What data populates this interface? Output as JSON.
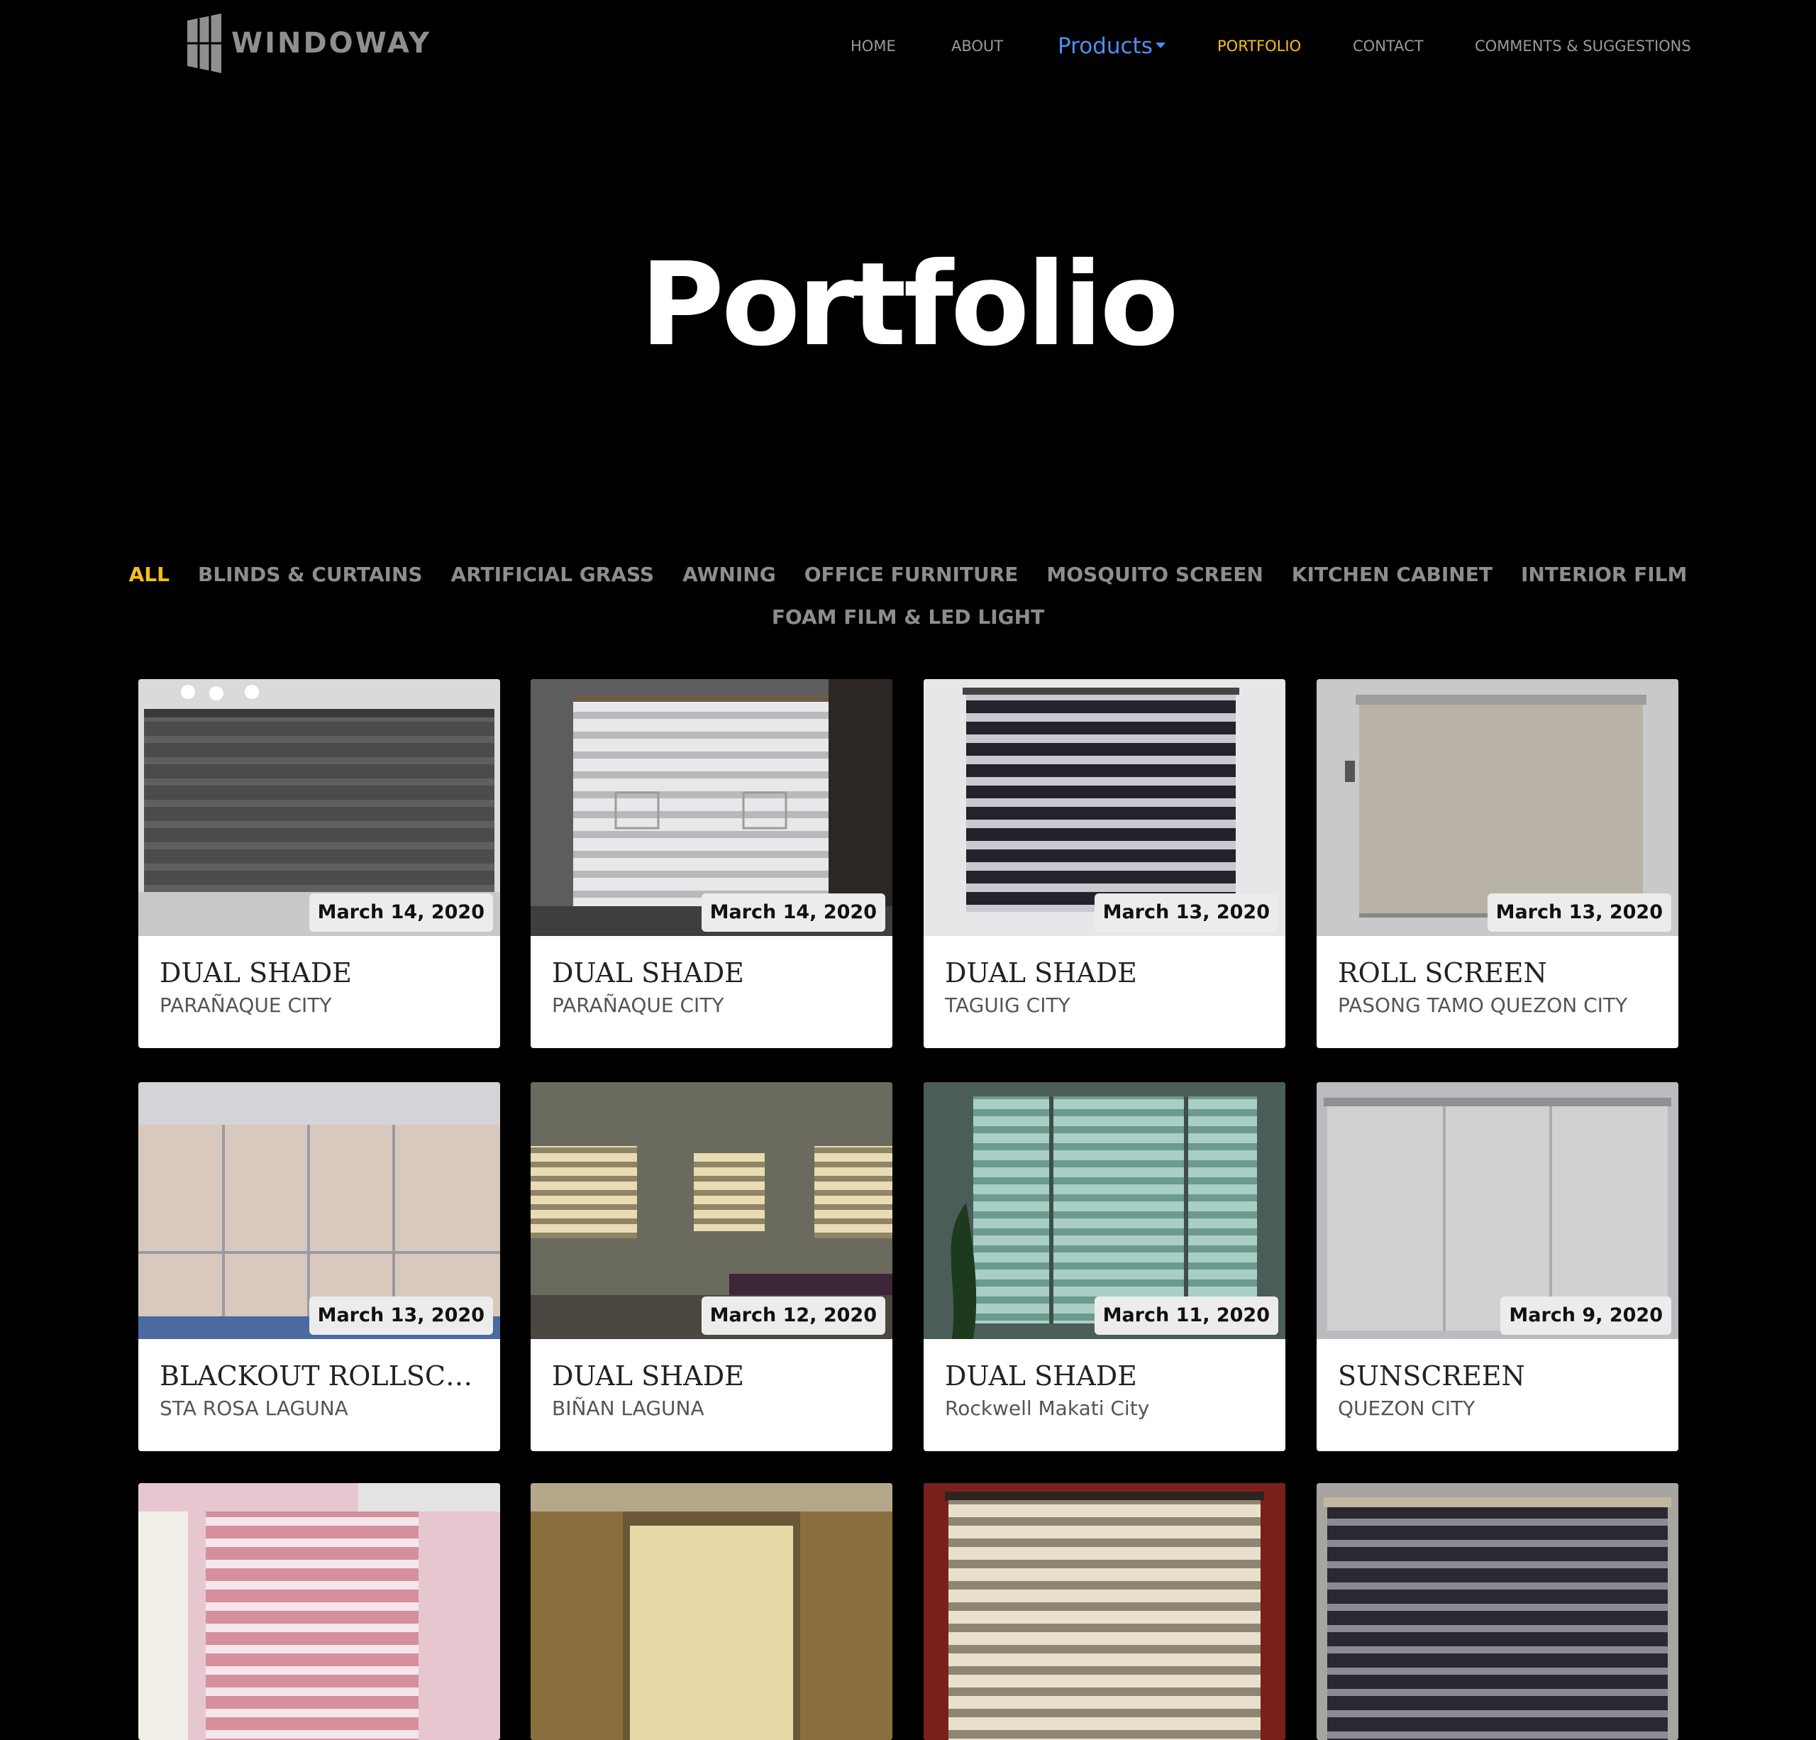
{
  "header": {
    "logo_text": "WINDOWAY",
    "nav": [
      {
        "label": "HOME"
      },
      {
        "label": "ABOUT"
      },
      {
        "label": "Products"
      },
      {
        "label": "PORTFOLIO"
      },
      {
        "label": "CONTACT"
      },
      {
        "label": "COMMENTS & SUGGESTIONS"
      }
    ]
  },
  "hero": {
    "title": "Portfolio"
  },
  "filters": {
    "row1": [
      "ALL",
      "BLINDS & CURTAINS",
      "ARTIFICIAL GRASS",
      "AWNING",
      "OFFICE FURNITURE",
      "MOSQUITO SCREEN",
      "KITCHEN CABINET",
      "INTERIOR FILM"
    ],
    "row2": [
      "FOAM FILM & LED LIGHT"
    ],
    "active": "ALL"
  },
  "projects": [
    {
      "date": "March 14, 2020",
      "title": "DUAL SHADE",
      "location": "PARAÑAQUE CITY"
    },
    {
      "date": "March 14, 2020",
      "title": "DUAL SHADE",
      "location": "PARAÑAQUE CITY"
    },
    {
      "date": "March 13, 2020",
      "title": "DUAL SHADE",
      "location": "TAGUIG CITY"
    },
    {
      "date": "March 13, 2020",
      "title": "ROLL SCREEN",
      "location": "PASONG TAMO QUEZON CITY"
    },
    {
      "date": "March 13, 2020",
      "title": "BLACKOUT ROLLSCREEN",
      "location": "STA ROSA LAGUNA"
    },
    {
      "date": "March 12, 2020",
      "title": "DUAL SHADE",
      "location": "BIÑAN LAGUNA"
    },
    {
      "date": "March 11, 2020",
      "title": "DUAL SHADE",
      "location": "Rockwell Makati City"
    },
    {
      "date": "March 9, 2020",
      "title": "SUNSCREEN",
      "location": "QUEZON CITY"
    },
    {
      "date": "",
      "title": "",
      "location": ""
    },
    {
      "date": "",
      "title": "",
      "location": ""
    },
    {
      "date": "",
      "title": "",
      "location": ""
    },
    {
      "date": "",
      "title": "",
      "location": ""
    }
  ],
  "colors": {
    "accent": "#f5c01a",
    "link": "#4d8ff0",
    "nav": "#9a9a9a",
    "background": "#000000"
  }
}
